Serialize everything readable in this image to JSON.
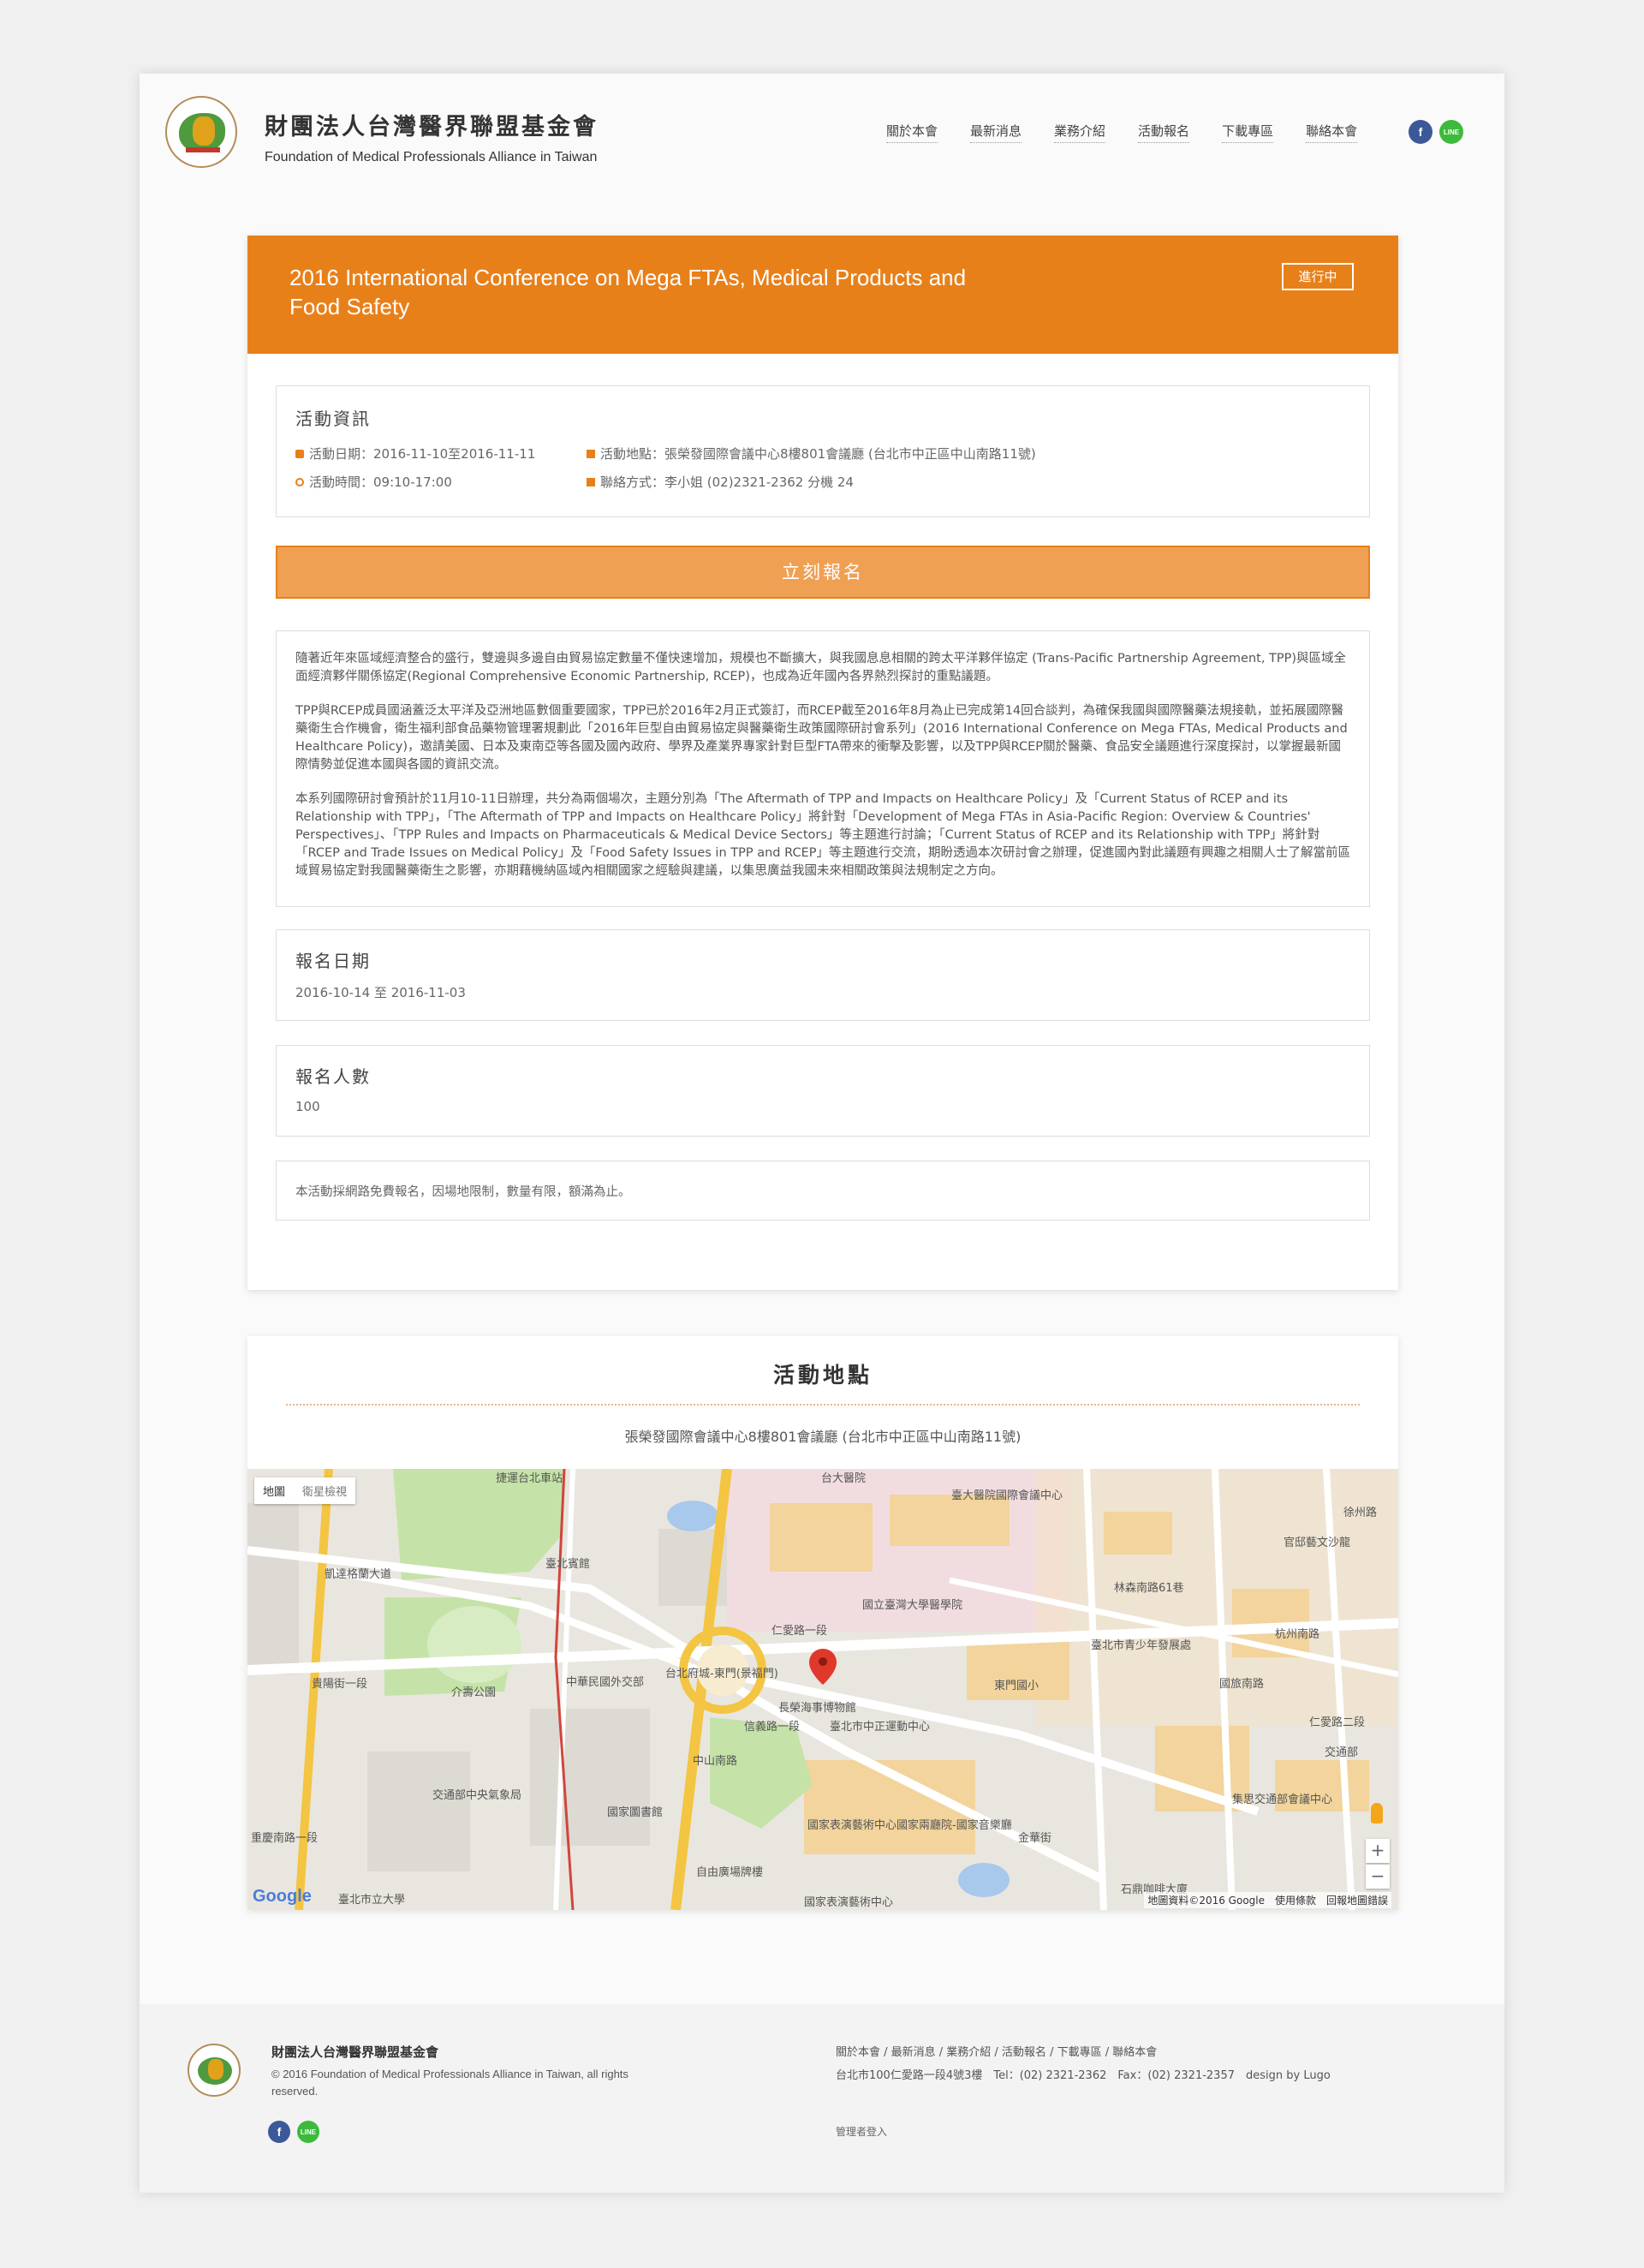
{
  "header": {
    "org_name_zh": "財團法人台灣醫界聯盟基金會",
    "org_name_en": "Foundation of Medical Professionals Alliance in Taiwan",
    "nav": [
      "關於本會",
      "最新消息",
      "業務介紹",
      "活動報名",
      "下載專區",
      "聯絡本會"
    ],
    "social": [
      "f",
      "LINE"
    ]
  },
  "event": {
    "title": "2016 International Conference on Mega FTAs, Medical Products and Food Safety",
    "status": "進行中",
    "info_heading": "活動資訊",
    "date_text": "活動日期：2016-11-10至2016-11-11",
    "time_text": "活動時間：09:10-17:00",
    "venue_text": "活動地點：張榮發國際會議中心8樓801會議廳 (台北市中正區中山南路11號)",
    "contact_text": "聯絡方式：李小姐 (02)2321-2362 分機 24",
    "signup_label": "立刻報名",
    "description": [
      "隨著近年來區域經濟整合的盛行，雙邊與多邊自由貿易協定數量不僅快速增加，規模也不斷擴大，與我國息息相關的跨太平洋夥伴協定 (Trans-Pacific Partnership Agreement, TPP)與區域全面經濟夥伴關係協定(Regional Comprehensive Economic Partnership, RCEP)，也成為近年國內各界熱烈探討的重點議題。",
      "TPP與RCEP成員國涵蓋泛太平洋及亞洲地區數個重要國家，TPP已於2016年2月正式簽訂，而RCEP截至2016年8月為止已完成第14回合談判，為確保我國與國際醫藥法規接軌，並拓展國際醫藥衛生合作機會，衛生福利部食品藥物管理署規劃此「2016年巨型自由貿易協定與醫藥衛生政策國際研討會系列」(2016 International Conference on Mega FTAs, Medical Products and Healthcare Policy)，邀請美國、日本及東南亞等各國及國內政府、學界及產業界專家針對巨型FTA帶來的衝擊及影響，以及TPP與RCEP關於醫藥、食品安全議題進行深度探討，以掌握最新國際情勢並促進本國與各國的資訊交流。",
      "本系列國際研討會預計於11月10-11日辦理，共分為兩個場次，主題分別為「The Aftermath of TPP and Impacts on Healthcare Policy」及「Current Status of RCEP and its Relationship with TPP」，「The Aftermath of TPP and Impacts on Healthcare Policy」將針對「Development of Mega FTAs in Asia-Pacific Region: Overview & Countries' Perspectives」、「TPP Rules and Impacts on Pharmaceuticals & Medical Device Sectors」等主題進行討論；「Current Status of RCEP and its Relationship with TPP」將針對「RCEP and Trade Issues on Medical Policy」及「Food Safety Issues in TPP and RCEP」等主題進行交流，期盼透過本次研討會之辦理，促進國內對此議題有興趣之相關人士了解當前區域貿易協定對我國醫藥衛生之影響，亦期藉機納區域內相關國家之經驗與建議，以集思廣益我國未來相關政策與法規制定之方向。"
    ],
    "signup_date_heading": "報名日期",
    "signup_date_value": "2016-10-14 至 2016-11-03",
    "signup_count_heading": "報名人數",
    "signup_count_value": "100",
    "note": "本活動採網路免費報名，因場地限制，數量有限，額滿為止。"
  },
  "location": {
    "heading": "活動地點",
    "address": "張榮發國際會議中心8樓801會議廳 (台北市中正區中山南路11號)",
    "map_type": [
      "地圖",
      "衛星檢視"
    ],
    "map_labels": [
      "台大醫院",
      "臺大醫院國際會議中心",
      "捷運台北車站",
      "凱達格蘭大道",
      "臺北賓館",
      "國立臺灣大學醫學院",
      "台北府城-東門(景福門)",
      "仁愛路一段",
      "中華民國外交部",
      "貴陽街一段",
      "介壽公園",
      "長榮海事博物館",
      "臺北市中正運動中心",
      "東門國小",
      "臺北市青少年發展處",
      "林森南路61巷",
      "杭州南路",
      "信義路一段",
      "交通部中央氣象局",
      "國家圖書館",
      "國家表演藝術中心國家兩廳院-國家音樂廳",
      "自由廣場牌樓",
      "國家表演藝術中心",
      "金華街",
      "臺北市立大學",
      "徐州路",
      "官邸藝文沙龍",
      "集思交通部會議中心",
      "交通部",
      "石鼎咖啡大廈",
      "仁愛路二段",
      "中山南路",
      "重慶南路一段",
      "國旅南路"
    ],
    "map_attribution": "地圖資料©2016 Google　使用條款　回報地圖錯誤",
    "google": "Google"
  },
  "footer": {
    "org_name": "財團法人台灣醫界聯盟基金會",
    "copyright": "© 2016 Foundation of Medical Professionals Alliance in Taiwan, all rights reserved.",
    "links": "關於本會 / 最新消息 / 業務介紹 / 活動報名 / 下載專區 / 聯絡本會",
    "address": "台北市100仁愛路一段4號3樓　Tel：(02) 2321-2362　Fax：(02) 2321-2357　design by Lugo",
    "admin": "管理者登入"
  },
  "colors": {
    "accent": "#e8801a",
    "signup": "#f0a053",
    "facebook": "#3b5998",
    "line": "#3cba3c"
  }
}
